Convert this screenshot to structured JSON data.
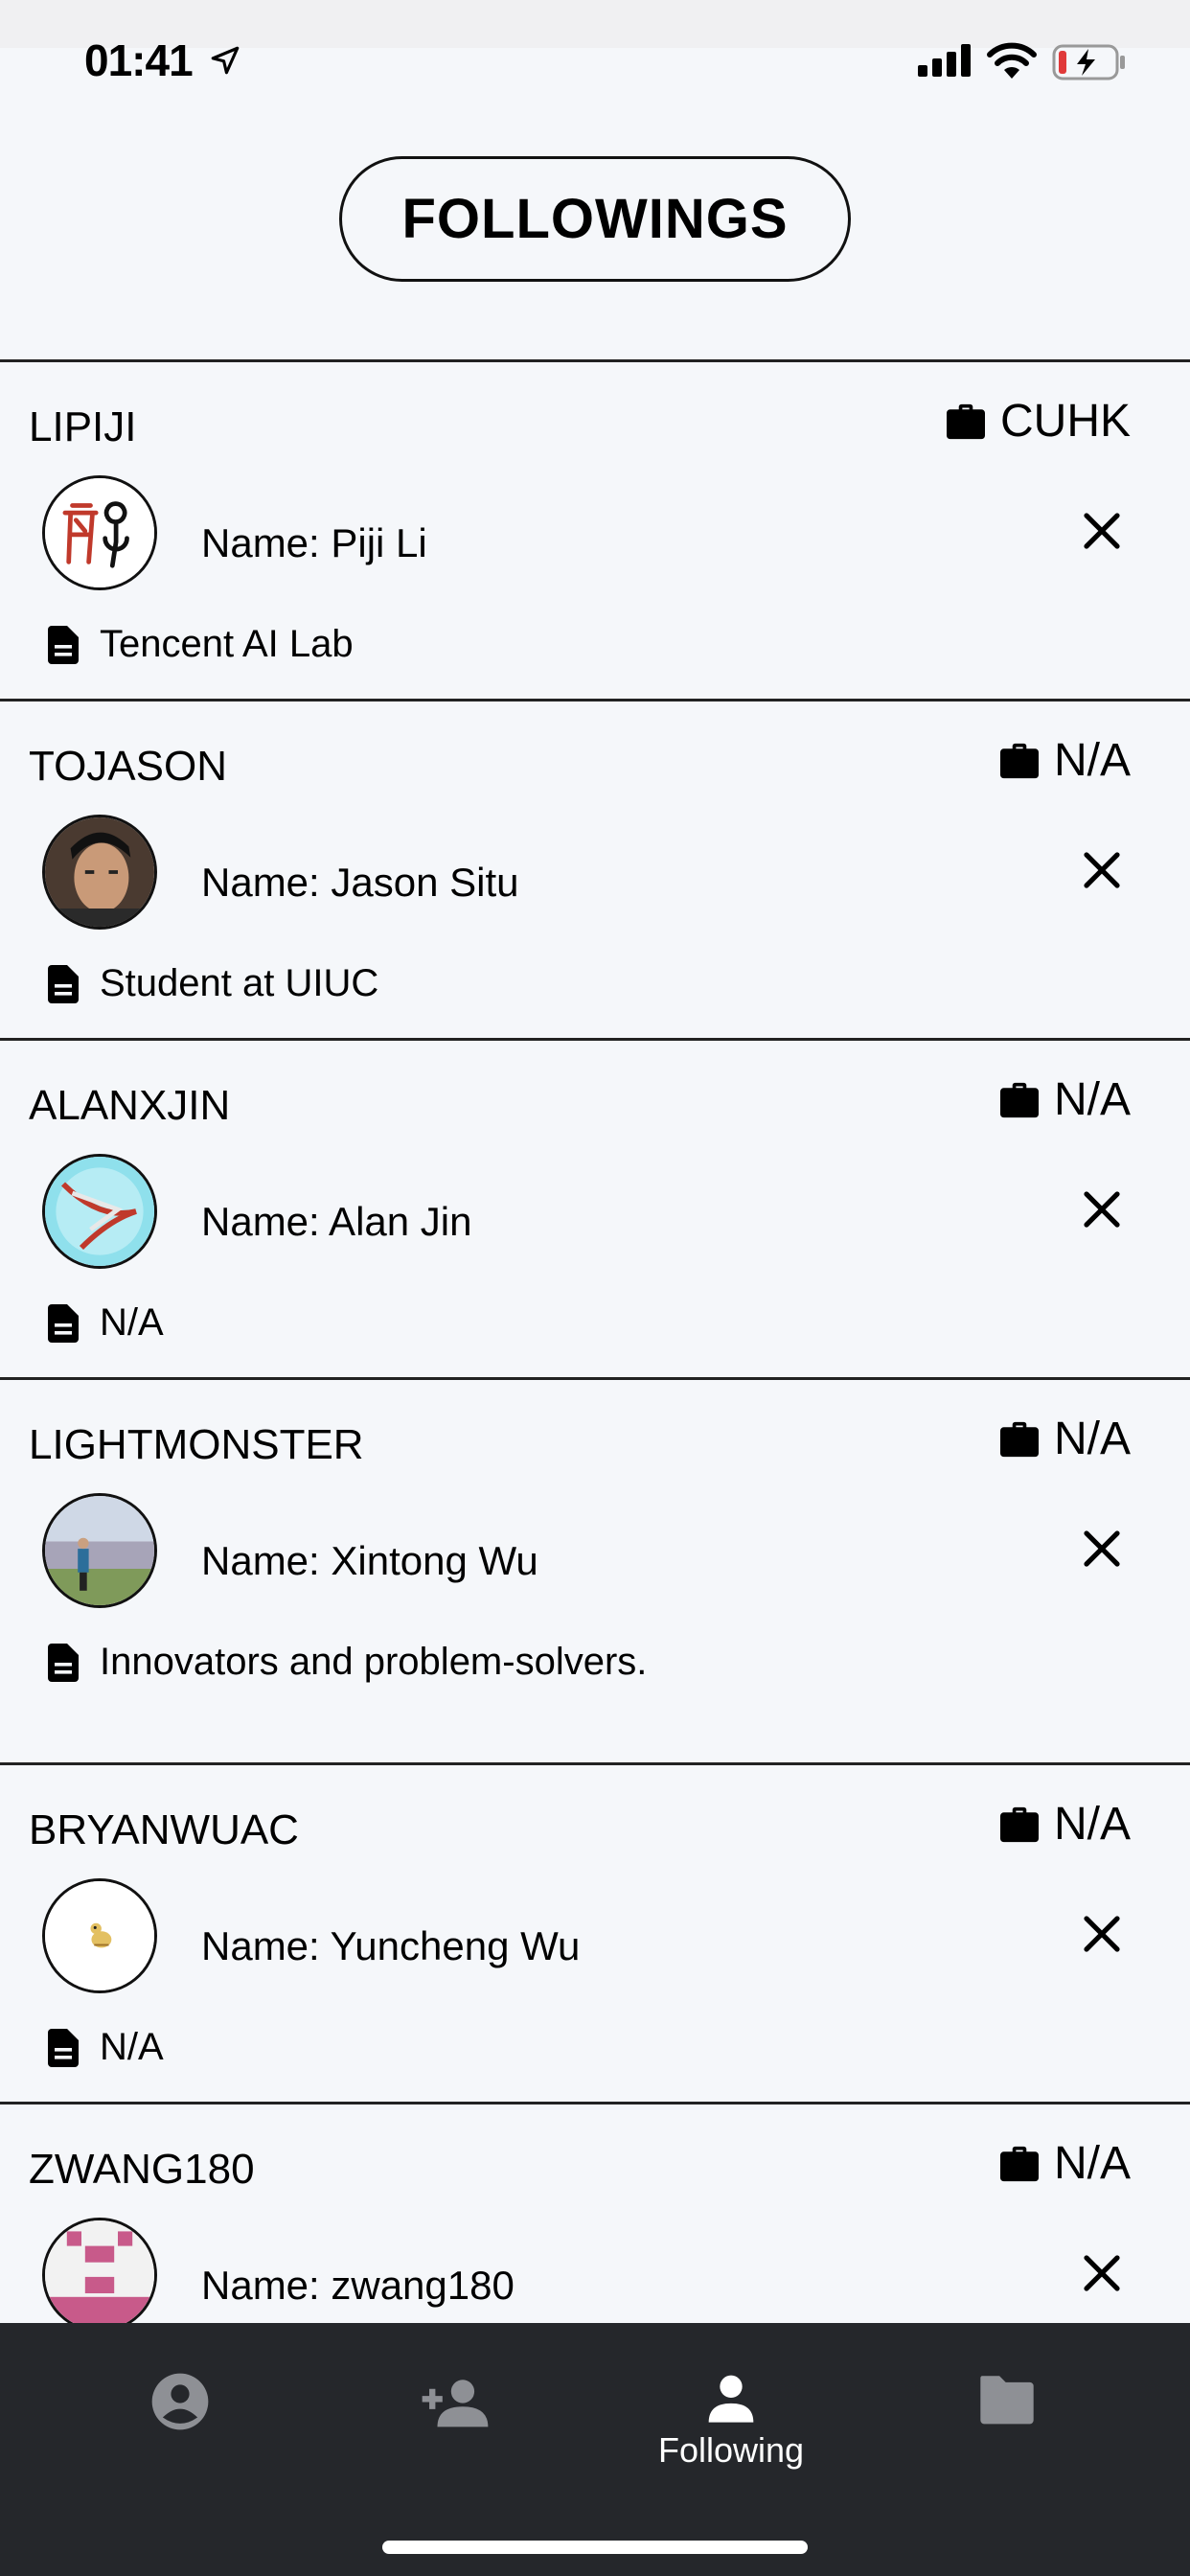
{
  "status_bar": {
    "time": "01:41"
  },
  "header": {
    "title": "FOLLOWINGS"
  },
  "followings": [
    {
      "username": "LIPIJI",
      "org": "CUHK",
      "name": "Name: Piji Li",
      "bio": "Tencent AI Lab"
    },
    {
      "username": "TOJASON",
      "org": "N/A",
      "name": "Name: Jason Situ",
      "bio": "Student at UIUC"
    },
    {
      "username": "ALANXJIN",
      "org": "N/A",
      "name": "Name: Alan Jin",
      "bio": "N/A"
    },
    {
      "username": "LIGHTMONSTER",
      "org": "N/A",
      "name": "Name: Xintong Wu",
      "bio": "Innovators and problem-solvers."
    },
    {
      "username": "BRYANWUAC",
      "org": "N/A",
      "name": "Name: Yuncheng Wu",
      "bio": "N/A"
    },
    {
      "username": "ZWANG180",
      "org": "N/A",
      "name": "Name: zwang180",
      "bio": ""
    }
  ],
  "tabs": [
    {
      "icon": "account-circle-icon",
      "label": ""
    },
    {
      "icon": "person-add-icon",
      "label": ""
    },
    {
      "icon": "person-icon",
      "label": "Following"
    },
    {
      "icon": "folder-icon",
      "label": ""
    }
  ],
  "colors": {
    "tabbar_bg": "#25272b",
    "active_tab": "#ffffff",
    "inactive_tab": "#8e9095",
    "background": "#f5f7fa"
  }
}
